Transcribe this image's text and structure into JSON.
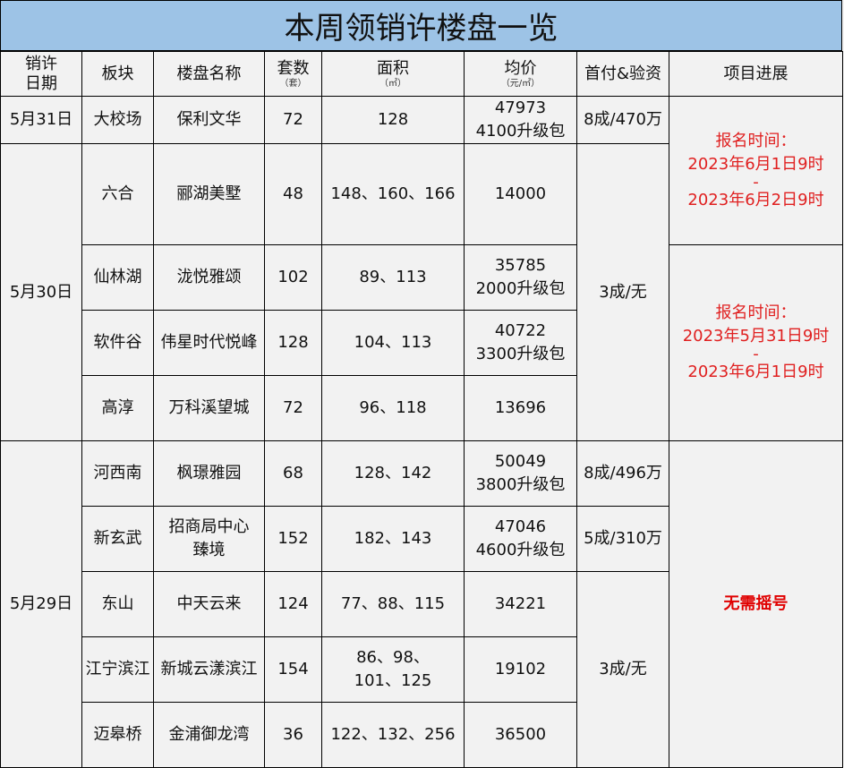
{
  "title": "本周领销许楼盘一览",
  "headers": {
    "date_line1": "销许",
    "date_line2": "日期",
    "district": "板块",
    "name": "楼盘名称",
    "units": "套数",
    "units_unit": "（套）",
    "area": "面积",
    "area_unit": "（㎡）",
    "price": "均价",
    "price_unit": "（元/㎡）",
    "payment": "首付&验资",
    "progress": "项目进展"
  },
  "dates": {
    "d1": "5月31日",
    "d2": "5月30日",
    "d3": "5月29日"
  },
  "rows": [
    {
      "district": "大校场",
      "name": "保利文华",
      "units": "72",
      "area": "128",
      "price": "47973",
      "price_extra": "4100升级包",
      "payment": "8成/470万"
    },
    {
      "district": "六合",
      "name": "郦湖美墅",
      "units": "48",
      "area": "148、160、166",
      "price": "14000"
    },
    {
      "district": "仙林湖",
      "name": "泷悦雅颂",
      "units": "102",
      "area": "89、113",
      "price": "35785",
      "price_extra": "2000升级包"
    },
    {
      "district": "软件谷",
      "name": "伟星时代悦峰",
      "units": "128",
      "area": "104、113",
      "price": "40722",
      "price_extra": "3300升级包"
    },
    {
      "district": "高淳",
      "name": "万科溪望城",
      "units": "72",
      "area": "96、118",
      "price": "13696"
    },
    {
      "district": "河西南",
      "name": "枫璟雅园",
      "units": "68",
      "area": "128、142",
      "price": "50049",
      "price_extra": "3800升级包",
      "payment": "8成/496万"
    },
    {
      "district": "新玄武",
      "name_line1": "招商局中心",
      "name_line2": "臻境",
      "units": "152",
      "area": "182、143",
      "price": "47046",
      "price_extra": "4600升级包",
      "payment": "5成/310万"
    },
    {
      "district": "东山",
      "name": "中天云来",
      "units": "124",
      "area": "77、88、115",
      "price": "34221"
    },
    {
      "district": "江宁滨江",
      "name": "新城云漾滨江",
      "units": "154",
      "area_line1": "86、98、",
      "area_line2": "101、125",
      "price": "19102"
    },
    {
      "district": "迈皋桥",
      "name": "金浦御龙湾",
      "units": "36",
      "area": "122、132、256",
      "price": "36500"
    }
  ],
  "merged_payment": {
    "group_a": "3成/无",
    "group_b": "3成/无"
  },
  "progress": {
    "block1": {
      "label": "报名时间：",
      "start": "2023年6月1日9时",
      "dash": "-",
      "end": "2023年6月2日9时"
    },
    "block2": {
      "label": "报名时间：",
      "start": "2023年5月31日9时",
      "dash": "-",
      "end": "2023年6月1日9时"
    },
    "block3": "无需摇号"
  },
  "colors": {
    "title_bg": "#9dc3e6",
    "cell_bg": "#f2f2f2",
    "accent_red": "#e02020"
  }
}
